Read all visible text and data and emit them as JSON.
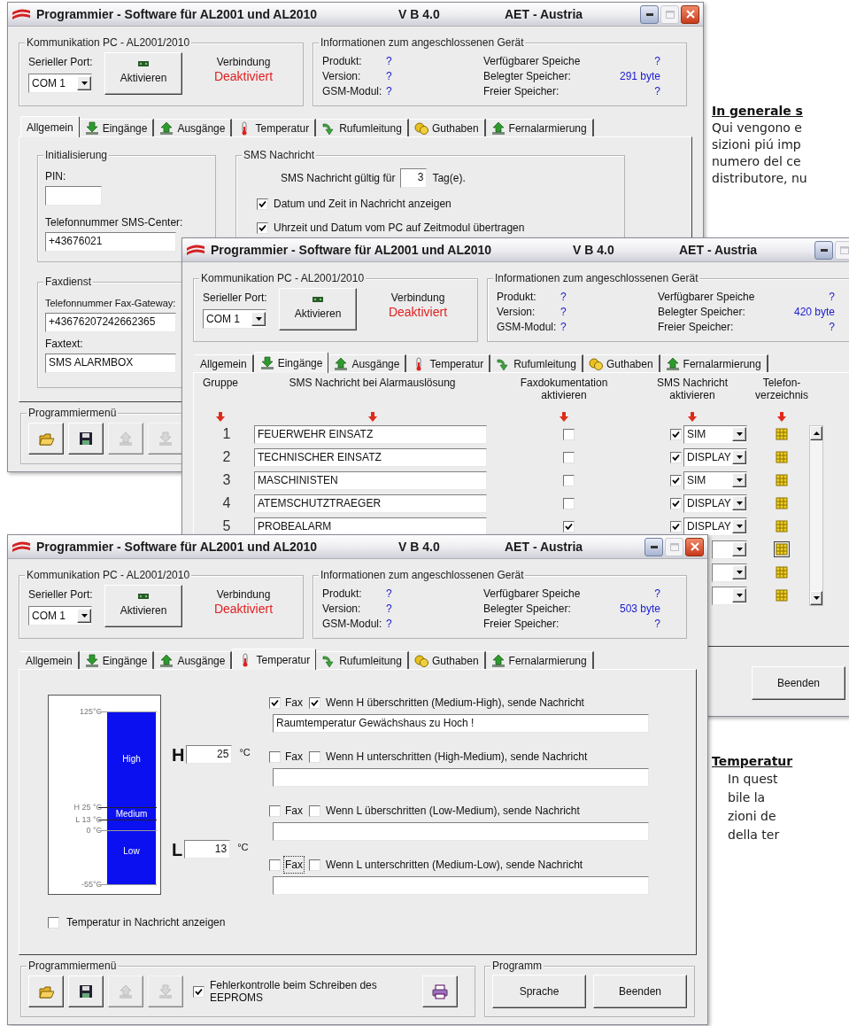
{
  "windows": [
    {
      "title": "Programmier - Software für AL2001 und AL2010",
      "version": "V B 4.0",
      "vendor": "AET - Austria",
      "communication": {
        "title": "Kommunikation PC - AL2001/2010",
        "port_label": "Serieller Port:",
        "port": "COM 1",
        "activate_button": "Aktivieren",
        "connection_label": "Verbindung",
        "connection_state": "Deaktiviert",
        "connected": false
      },
      "device_info": {
        "title": "Informationen zum angeschlossenen Gerät",
        "rows": [
          {
            "label": "Produkt:",
            "value": "?"
          },
          {
            "label": "Verfügbarer Speiche",
            "value": "?"
          },
          {
            "label": "Version:",
            "value": "?"
          },
          {
            "label": "Belegter Speicher:",
            "value": "291 byte"
          },
          {
            "label": "GSM-Modul:",
            "value": "?"
          },
          {
            "label": "Freier Speicher:",
            "value": "?"
          }
        ]
      },
      "tabs": [
        {
          "label": "Allgemein",
          "selected": true
        },
        {
          "label": "Eingänge",
          "selected": false
        },
        {
          "label": "Ausgänge",
          "selected": false
        },
        {
          "label": "Temperatur",
          "selected": false
        },
        {
          "label": "Rufumleitung",
          "selected": false
        },
        {
          "label": "Guthaben",
          "selected": false
        },
        {
          "label": "Fernalarmierung",
          "selected": false
        }
      ],
      "page": {
        "kind": "general",
        "initialization": {
          "title": "Initialisierung",
          "pin_label": "PIN:",
          "sms_center_label": "Telefonnummer SMS-Center:",
          "sms_center": "+43676021"
        },
        "sms": {
          "title": "SMS Nachricht",
          "validity_label": "SMS Nachricht gültig für",
          "validity_days": "3",
          "validity_unit": "Tag(e).",
          "options": [
            {
              "label": "Datum und Zeit in Nachricht anzeigen",
              "checked": true
            },
            {
              "label": "Uhrzeit und Datum vom PC auf Zeitmodul übertragen",
              "checked": true
            }
          ]
        },
        "fax": {
          "title": "Faxdienst",
          "gateway_label": "Telefonnummer Fax-Gateway:",
          "gateway": "+43676207242662365",
          "text_label": "Faxtext:",
          "text": "SMS ALARMBOX"
        }
      },
      "program_menu": {
        "title": "Programmiermenü",
        "tools": [
          {
            "disabled": false
          },
          {
            "disabled": false
          },
          {
            "disabled": true
          },
          {
            "disabled": true
          }
        ]
      }
    },
    {
      "title": "Programmier - Software für AL2001 und AL2010",
      "version": "V B 4.0",
      "vendor": "AET - Austria",
      "communication": {
        "title": "Kommunikation PC - AL2001/2010",
        "port_label": "Serieller Port:",
        "port": "COM 1",
        "activate_button": "Aktivieren",
        "connection_label": "Verbindung",
        "connection_state": "Deaktiviert",
        "connected": false
      },
      "device_info": {
        "title": "Informationen zum angeschlossenen Gerät",
        "rows": [
          {
            "label": "Produkt:",
            "value": "?"
          },
          {
            "label": "Verfügbarer Speiche",
            "value": "?"
          },
          {
            "label": "Version:",
            "value": "?"
          },
          {
            "label": "Belegter Speicher:",
            "value": "420 byte"
          },
          {
            "label": "GSM-Modul:",
            "value": "?"
          },
          {
            "label": "Freier Speicher:",
            "value": "?"
          }
        ]
      },
      "tabs": [
        {
          "label": "Allgemein",
          "selected": false
        },
        {
          "label": "Eingänge",
          "selected": true
        },
        {
          "label": "Ausgänge",
          "selected": false
        },
        {
          "label": "Temperatur",
          "selected": false
        },
        {
          "label": "Rufumleitung",
          "selected": false
        },
        {
          "label": "Guthaben",
          "selected": false
        },
        {
          "label": "Fernalarmierung",
          "selected": false
        }
      ],
      "page": {
        "kind": "inputs",
        "columns": [
          "Gruppe",
          "SMS Nachricht bei Alarmauslösung",
          "Faxdokumentation aktivieren",
          "SMS Nachricht aktivieren",
          "Telefon- verzeichnis"
        ],
        "rows": [
          {
            "group": "1",
            "message": "FEUERWEHR EINSATZ",
            "fax": false,
            "sms": true,
            "target": "SIM",
            "phonebook_active": false
          },
          {
            "group": "2",
            "message": "TECHNISCHER EINSATZ",
            "fax": false,
            "sms": true,
            "target": "DISPLAY",
            "phonebook_active": false
          },
          {
            "group": "3",
            "message": "MASCHINISTEN",
            "fax": false,
            "sms": true,
            "target": "SIM",
            "phonebook_active": false
          },
          {
            "group": "4",
            "message": "ATEMSCHUTZTRAEGER",
            "fax": false,
            "sms": true,
            "target": "DISPLAY",
            "phonebook_active": false
          },
          {
            "group": "5",
            "message": "PROBEALARM",
            "fax": true,
            "sms": true,
            "target": "DISPLAY",
            "phonebook_active": false
          },
          {
            "phonebook_active": true
          },
          {
            "phonebook_active": false
          },
          {
            "phonebook_active": false
          }
        ]
      },
      "program": {
        "buttons": [
          {
            "label": "Beenden"
          }
        ]
      }
    },
    {
      "title": "Programmier - Software für AL2001 und AL2010",
      "version": "V B 4.0",
      "vendor": "AET - Austria",
      "communication": {
        "title": "Kommunikation PC - AL2001/2010",
        "port_label": "Serieller Port:",
        "port": "COM 1",
        "activate_button": "Aktivieren",
        "connection_label": "Verbindung",
        "connection_state": "Deaktiviert",
        "connected": false
      },
      "device_info": {
        "title": "Informationen zum angeschlossenen Gerät",
        "rows": [
          {
            "label": "Produkt:",
            "value": "?"
          },
          {
            "label": "Verfügbarer Speiche",
            "value": "?"
          },
          {
            "label": "Version:",
            "value": "?"
          },
          {
            "label": "Belegter Speicher:",
            "value": "503 byte"
          },
          {
            "label": "GSM-Modul:",
            "value": "?"
          },
          {
            "label": "Freier Speicher:",
            "value": "?"
          }
        ]
      },
      "tabs": [
        {
          "label": "Allgemein",
          "selected": false
        },
        {
          "label": "Eingänge",
          "selected": false
        },
        {
          "label": "Ausgänge",
          "selected": false
        },
        {
          "label": "Temperatur",
          "selected": true
        },
        {
          "label": "Rufumleitung",
          "selected": false
        },
        {
          "label": "Guthaben",
          "selected": false
        },
        {
          "label": "Fernalarmierung",
          "selected": false
        }
      ],
      "page": {
        "kind": "temperature",
        "scale": {
          "top": "125°C",
          "high_marker": "H 25 °C",
          "low_marker": "L 13 °C",
          "zero": "0 °C",
          "bottom": "-55°C",
          "bands": [
            "High",
            "Medium",
            "Low"
          ]
        },
        "high": {
          "letter": "H",
          "value": "25",
          "unit": "°C"
        },
        "low": {
          "letter": "L",
          "value": "13",
          "unit": "°C"
        },
        "alarms": [
          {
            "fax_label": "Fax",
            "fax": true,
            "send": true,
            "label": "Wenn H überschritten (Medium-High), sende Nachricht",
            "message": "Raumtemperatur Gewächshaus zu Hoch !",
            "focused": false
          },
          {
            "fax_label": "Fax",
            "fax": false,
            "send": false,
            "label": "Wenn H unterschritten (High-Medium), sende Nachricht",
            "focused": false
          },
          {
            "fax_label": "Fax",
            "fax": false,
            "send": false,
            "label": "Wenn L überschritten (Low-Medium), sende Nachricht",
            "focused": false
          },
          {
            "fax_label": "Fax",
            "fax": false,
            "send": false,
            "label": "Wenn L unterschritten (Medium-Low), sende Nachricht",
            "focused": true
          }
        ],
        "show_temperature": {
          "label": "Temperatur in Nachricht anzeigen",
          "checked": false
        }
      },
      "program_menu": {
        "title": "Programmiermenü",
        "tools": [
          {
            "disabled": false
          },
          {
            "disabled": false
          },
          {
            "disabled": true
          },
          {
            "disabled": true
          }
        ],
        "error_check": {
          "label": "Fehlerkontrolle beim Schreiben des EEPROMS",
          "checked": true
        },
        "print": {
          "disabled": false
        }
      },
      "program": {
        "title": "Programm",
        "buttons": [
          {
            "label": "Sprache"
          },
          {
            "label": "Beenden"
          }
        ]
      }
    }
  ],
  "notes": [
    {
      "heading": "In generale s",
      "lines": [
        "Qui vengono e",
        "sizioni piú imp",
        "numero del ce",
        "distributore, nu"
      ]
    },
    {
      "heading": "Temperatur",
      "lines": [
        "In quest",
        "bile la",
        "zioni de",
        "della ter"
      ]
    }
  ]
}
